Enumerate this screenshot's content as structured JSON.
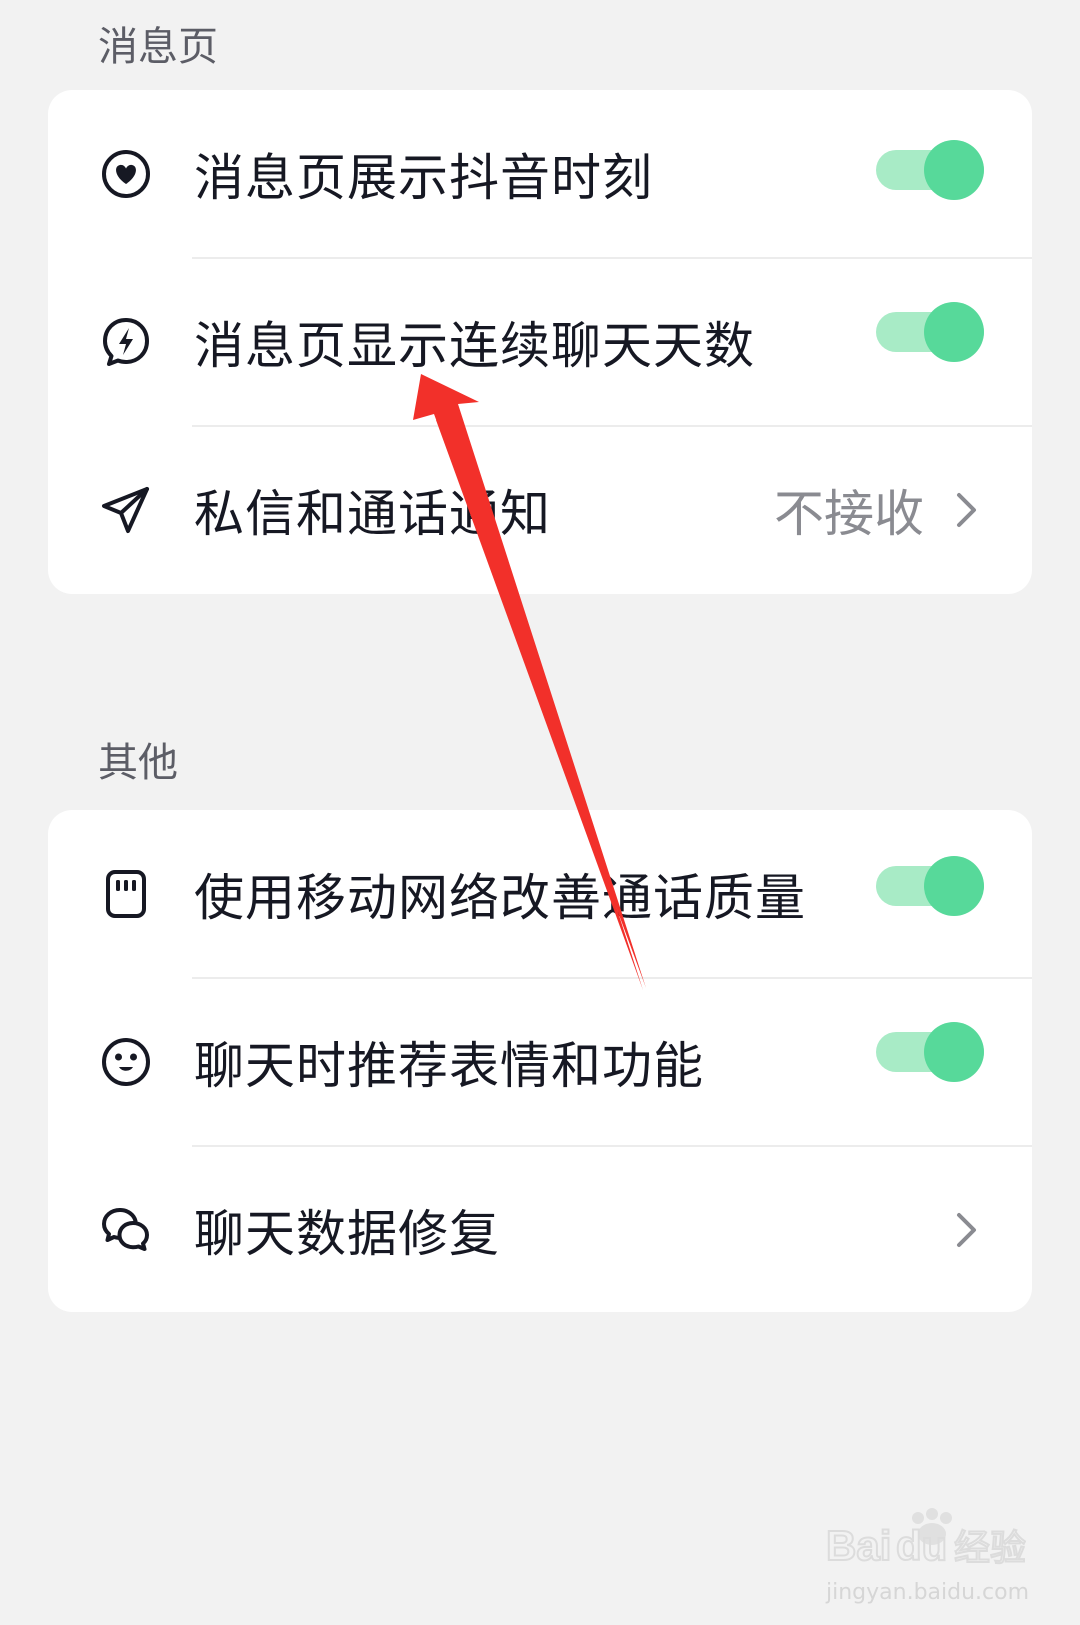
{
  "sections": [
    {
      "title": "消息页",
      "items": [
        {
          "label": "消息页展示抖音时刻",
          "icon": "heart-circle-icon",
          "control": "toggle",
          "on": true
        },
        {
          "label": "消息页显示连续聊天天数",
          "icon": "lightning-bubble-icon",
          "control": "toggle",
          "on": true
        },
        {
          "label": "私信和通话通知",
          "icon": "send-icon",
          "control": "link",
          "value": "不接收"
        }
      ]
    },
    {
      "title": "其他",
      "items": [
        {
          "label": "使用移动网络改善通话质量",
          "icon": "sim-card-icon",
          "control": "toggle",
          "on": true
        },
        {
          "label": "聊天时推荐表情和功能",
          "icon": "smiley-icon",
          "control": "toggle",
          "on": true
        },
        {
          "label": "聊天数据修复",
          "icon": "chat-bubbles-icon",
          "control": "link",
          "value": ""
        }
      ]
    }
  ],
  "colors": {
    "toggle_track": "#a8ebc6",
    "toggle_knob": "#57d99a",
    "annotation_arrow": "#f2302a",
    "background": "#f2f2f2"
  },
  "watermark": {
    "logo_text": "Baidu经验",
    "url": "jingyan.baidu.com"
  }
}
